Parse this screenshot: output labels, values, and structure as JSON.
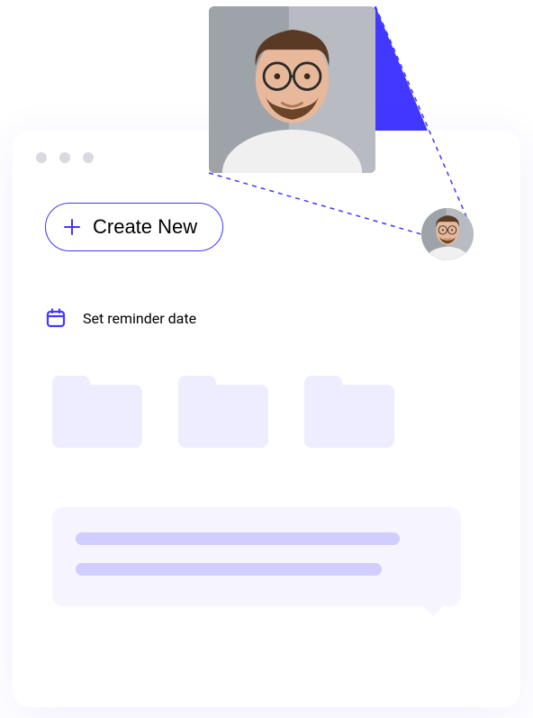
{
  "buttons": {
    "create_label": "Create New"
  },
  "reminder": {
    "label": "Set reminder date"
  },
  "icons": {
    "plus": "plus-icon",
    "calendar": "calendar-icon"
  },
  "avatar": {
    "desc": "man-with-glasses"
  }
}
